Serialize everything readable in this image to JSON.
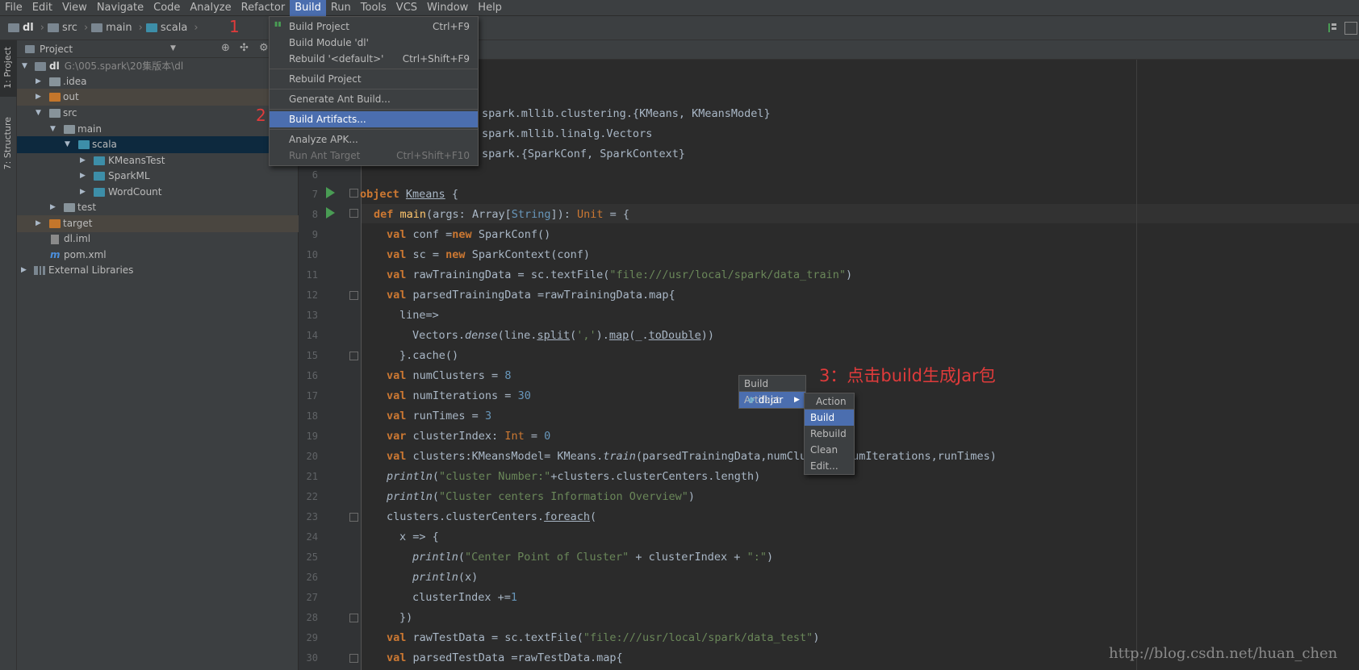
{
  "menubar": [
    "File",
    "Edit",
    "View",
    "Navigate",
    "Code",
    "Analyze",
    "Refactor",
    "Build",
    "Run",
    "Tools",
    "VCS",
    "Window",
    "Help"
  ],
  "breadcrumb": [
    "dl",
    "src",
    "main",
    "scala"
  ],
  "annotations": {
    "one": "1",
    "two": "2",
    "three": "3：点击build生成Jar包"
  },
  "toolstrip": {
    "project_tab": "1: Project",
    "structure_tab": "7: Structure"
  },
  "project_panel": {
    "title": "Project",
    "root": {
      "name": "dl",
      "path": "G:\\005.spark\\20集版本\\dl"
    },
    "items": [
      ".idea",
      "out",
      "src",
      "main",
      "scala",
      "KMeansTest",
      "SparkML",
      "WordCount",
      "test",
      "target",
      "dl.iml",
      "pom.xml",
      "External Libraries"
    ]
  },
  "build_menu": [
    {
      "label": "Build Project",
      "shortcut": "Ctrl+F9"
    },
    {
      "label": "Build Module 'dl'",
      "shortcut": ""
    },
    {
      "label": "Rebuild '<default>'",
      "shortcut": "Ctrl+Shift+F9"
    },
    {
      "label": "Rebuild Project",
      "shortcut": ""
    },
    {
      "label": "Generate Ant Build...",
      "shortcut": ""
    },
    {
      "label": "Build Artifacts...",
      "shortcut": ""
    },
    {
      "label": "Analyze APK...",
      "shortcut": ""
    },
    {
      "label": "Run Ant Target",
      "shortcut": "Ctrl+Shift+F10"
    }
  ],
  "artifact_popup": {
    "title": "Build Artifact",
    "artifact": "dl:jar"
  },
  "action_menu": [
    "Action",
    "Build",
    "Rebuild",
    "Clean",
    "Edit..."
  ],
  "code": {
    "line_numbers": [
      "6",
      "7",
      "8",
      "9",
      "10",
      "11",
      "12",
      "13",
      "14",
      "15",
      "16",
      "17",
      "18",
      "19",
      "20",
      "21",
      "22",
      "23",
      "24",
      "25",
      "26",
      "27",
      "28",
      "29",
      "30"
    ],
    "imports": [
      "spark.mllib.clustering.{KMeans, KMeansModel}",
      "spark.mllib.linalg.Vectors",
      "spark.{SparkConf, SparkContext}"
    ]
  },
  "watermark": "http://blog.csdn.net/huan_chen"
}
